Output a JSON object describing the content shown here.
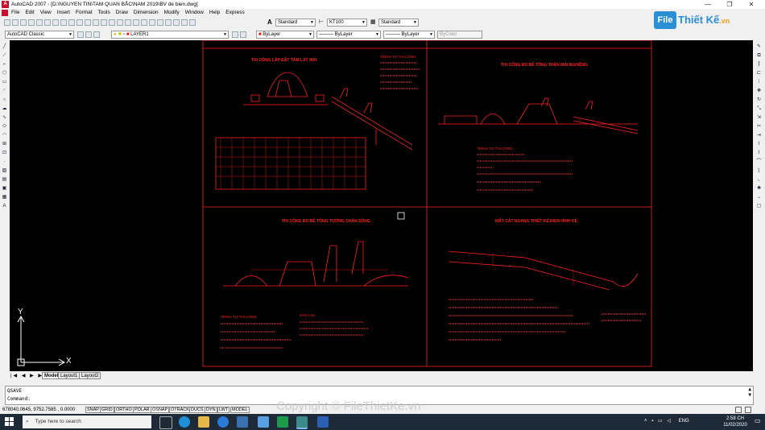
{
  "window": {
    "title": "AutoCAD 2007 - [D:\\NGUYEN TIN\\TAM QUAN BẮC\\NAM 2019\\BV de bien.dwg]",
    "app_icon": "A"
  },
  "menu": [
    "File",
    "Edit",
    "View",
    "Insert",
    "Format",
    "Tools",
    "Draw",
    "Dimension",
    "Modify",
    "Window",
    "Help",
    "Express"
  ],
  "toolbar": {
    "text_style": "Standard",
    "dim_style": "KT100",
    "table_style": "Standard",
    "workspace": "AutoCAD Classic",
    "layer": "LAYER1",
    "color": "ByLayer",
    "linetype": "ByLayer",
    "lineweight": "ByLayer",
    "plot_style": "ByColor"
  },
  "drawing": {
    "panels": [
      {
        "title": "THI CÔNG LẮP ĐẶT TẤM LÁT MÁI",
        "notes_title": "TRÌNH TỰ THI CÔNG"
      },
      {
        "title": "THI CÔNG ĐỔ BÊ TÔNG THÂN MÁI NGHIÊNG",
        "notes_title": "TRÌNH TỰ THI CÔNG"
      },
      {
        "title": "THI CÔNG ĐỔ BÊ TÔNG TƯỜNG CHẮN SÓNG",
        "notes_title": "TRÌNH TỰ THI CÔNG",
        "notes_title_2": "GHI CHÚ"
      },
      {
        "title": "MẶT CẮT NGANG THIẾT KẾ ĐIỂN HÌNH KÈ",
        "notes_title": ""
      }
    ],
    "ucs_y": "Y",
    "ucs_x": "X"
  },
  "tabs": [
    "Model",
    "Layout1",
    "Layout2"
  ],
  "command": {
    "line1": "QSAVE",
    "line2": "Command:"
  },
  "status": {
    "coords": "678040.0645, 9752.7585 , 0.0000",
    "buttons": [
      "SNAP",
      "GRID",
      "ORTHO",
      "POLAR",
      "OSNAP",
      "OTRACK",
      "DUCS",
      "DYN",
      "LWT",
      "MODEL"
    ]
  },
  "taskbar": {
    "search_placeholder": "Type here to search",
    "time": "2:58 CH",
    "date": "11/02/2020",
    "lang": "ENG"
  },
  "watermark": {
    "logo_left": "File",
    "logo_right": "Thiết Kế",
    "logo_tld": ".vn",
    "copyright": "Copyright © FileThietKe.vn"
  },
  "colors": {
    "accent_red": "#ff2020",
    "canvas": "#000000",
    "taskbar": "#1f2a38",
    "logo_blue": "#2b8fd6"
  }
}
